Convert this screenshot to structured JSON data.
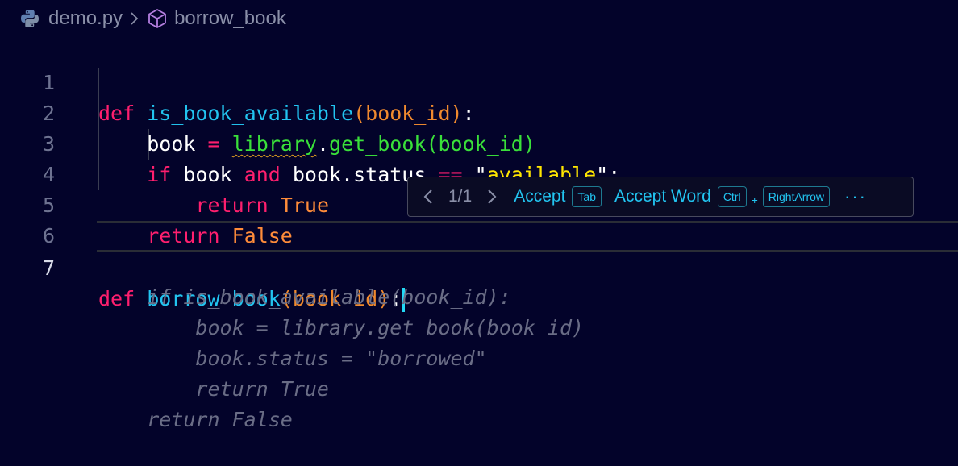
{
  "breadcrumb": {
    "file": "demo.py",
    "symbol": "borrow_book"
  },
  "colors": {
    "background": "#03032a",
    "accent": "#22c4f0",
    "keyword": "#ff1f6e",
    "call": "#3ae03a",
    "string": "#ffe600",
    "param": "#f08a2e"
  },
  "icons": [
    "python-icon",
    "chevron-right-icon",
    "cube-icon",
    "chevron-left-icon",
    "more-icon"
  ],
  "editor": {
    "line_numbers": [
      "1",
      "2",
      "3",
      "4",
      "5",
      "6",
      "7"
    ],
    "active_line": "7",
    "l1": {
      "def": "def",
      "name": "is_book_available",
      "open": "(",
      "param": "book_id",
      "close": ")",
      "colon": ":"
    },
    "l2": {
      "var": "book",
      "eq": " = ",
      "obj": "library",
      "dot": ".",
      "method": "get_book",
      "open": "(",
      "arg": "book_id",
      "close": ")"
    },
    "l3": {
      "if": "if",
      "a": " book ",
      "and": "and",
      "b": " book.status ",
      "eqeq": "==",
      "sp": " ",
      "q1": "\"",
      "str": "available",
      "q2": "\"",
      "colon": ":"
    },
    "l4": {
      "return": "return",
      "val": "True"
    },
    "l5": {
      "return": "return",
      "val": "False"
    },
    "l7": {
      "def": "def",
      "name": "borrow_book",
      "open": "(",
      "param": "book_id",
      "close": ")",
      "colon": ":"
    },
    "ghost": [
      "if is_book_available(book_id):",
      "book = library.get_book(book_id)",
      "book.status = \"borrowed\"",
      "return True",
      "return False"
    ]
  },
  "suggestion_toolbar": {
    "count": "1/1",
    "accept_label": "Accept",
    "accept_key": "Tab",
    "accept_word_label": "Accept Word",
    "accept_word_key1": "Ctrl",
    "plus": "+",
    "accept_word_key2": "RightArrow",
    "more": "···"
  }
}
